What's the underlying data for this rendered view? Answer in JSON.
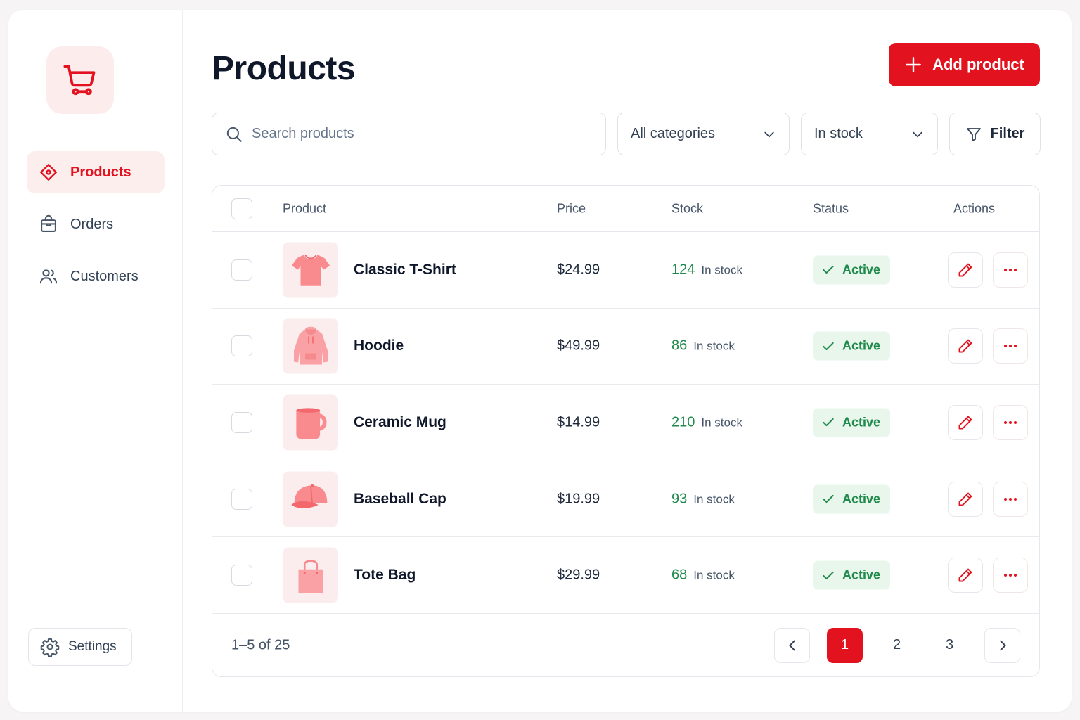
{
  "colors": {
    "accent": "#e3121f",
    "success": "#1f8a4c",
    "success_bg": "#e8f6ec"
  },
  "sidebar": {
    "logo_icon": "shopping-cart-icon",
    "items": [
      {
        "label": "Products",
        "icon": "tag-icon",
        "active": true
      },
      {
        "label": "Orders",
        "icon": "shopping-bag-icon",
        "active": false
      },
      {
        "label": "Customers",
        "icon": "users-icon",
        "active": false
      }
    ],
    "settings_label": "Settings"
  },
  "header": {
    "title": "Products",
    "add_label": "Add product"
  },
  "toolbar": {
    "search_placeholder": "Search products",
    "category_value": "All categories",
    "stock_value": "In stock",
    "filter_label": "Filter"
  },
  "table": {
    "columns": {
      "product": "Product",
      "price": "Price",
      "stock": "Stock",
      "status": "Status",
      "actions": "Actions"
    },
    "rows": [
      {
        "name": "Classic T-Shirt",
        "price": "$24.99",
        "stock": "124",
        "stock_label": "In stock",
        "status": "Active",
        "thumb": "tshirt-icon"
      },
      {
        "name": "Hoodie",
        "price": "$49.99",
        "stock": "86",
        "stock_label": "In stock",
        "status": "Active",
        "thumb": "hoodie-icon"
      },
      {
        "name": "Ceramic Mug",
        "price": "$14.99",
        "stock": "210",
        "stock_label": "In stock",
        "status": "Active",
        "thumb": "mug-icon"
      },
      {
        "name": "Baseball Cap",
        "price": "$19.99",
        "stock": "93",
        "stock_label": "In stock",
        "status": "Active",
        "thumb": "cap-icon"
      },
      {
        "name": "Tote Bag",
        "price": "$29.99",
        "stock": "68",
        "stock_label": "In stock",
        "status": "Active",
        "thumb": "tote-bag-icon"
      }
    ]
  },
  "pagination": {
    "range": "1–5 of 25",
    "pages": [
      "1",
      "2",
      "3"
    ],
    "current": "1"
  }
}
